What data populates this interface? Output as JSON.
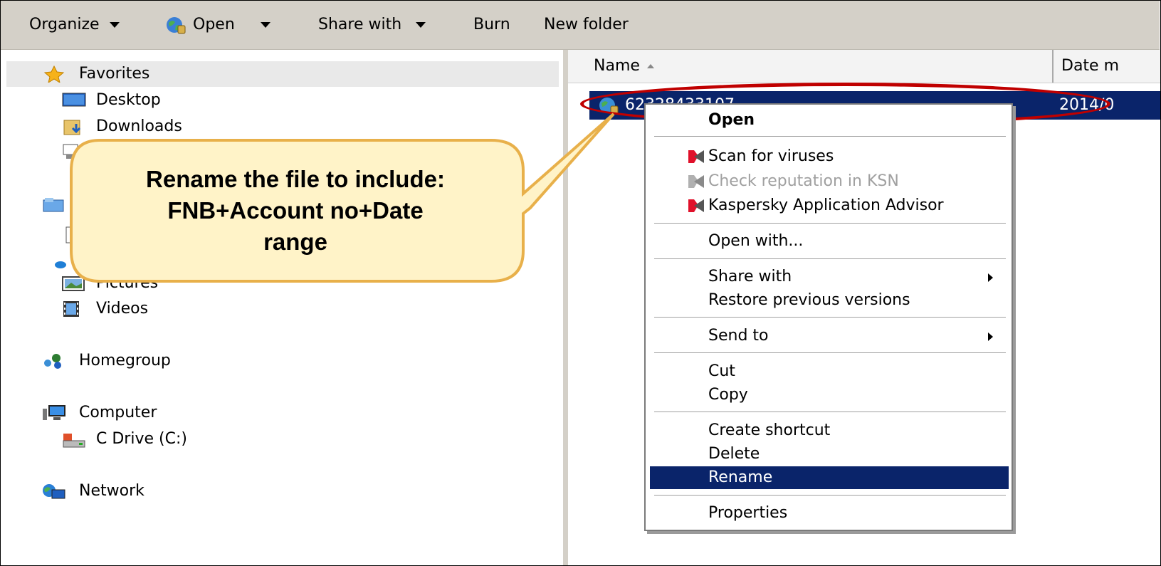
{
  "toolbar": {
    "organize": "Organize",
    "open": "Open",
    "share_with": "Share with",
    "burn": "Burn",
    "new_folder": "New folder"
  },
  "nav": {
    "favorites": "Favorites",
    "desktop": "Desktop",
    "downloads": "Downloads",
    "pictures": "Pictures",
    "videos": "Videos",
    "homegroup": "Homegroup",
    "computer": "Computer",
    "c_drive": "C Drive (C:)",
    "network": "Network"
  },
  "columns": {
    "name": "Name",
    "date": "Date m"
  },
  "file": {
    "name": "62328433107",
    "date": "2014/0"
  },
  "context_menu": {
    "open": "Open",
    "scan": "Scan for viruses",
    "check_reputation": "Check reputation in KSN",
    "kaspersky_advisor": "Kaspersky Application Advisor",
    "open_with": "Open with...",
    "share_with": "Share with",
    "restore": "Restore previous versions",
    "send_to": "Send to",
    "cut": "Cut",
    "copy": "Copy",
    "create_shortcut": "Create shortcut",
    "delete": "Delete",
    "rename": "Rename",
    "properties": "Properties"
  },
  "callout": {
    "line1": "Rename the file to include:",
    "line2": "FNB+Account no+Date",
    "line3": "range"
  },
  "colors": {
    "selection": "#0a246a",
    "highlight": "#c00000",
    "callout_fill": "#fff3c8",
    "callout_border": "#e8b04a"
  }
}
